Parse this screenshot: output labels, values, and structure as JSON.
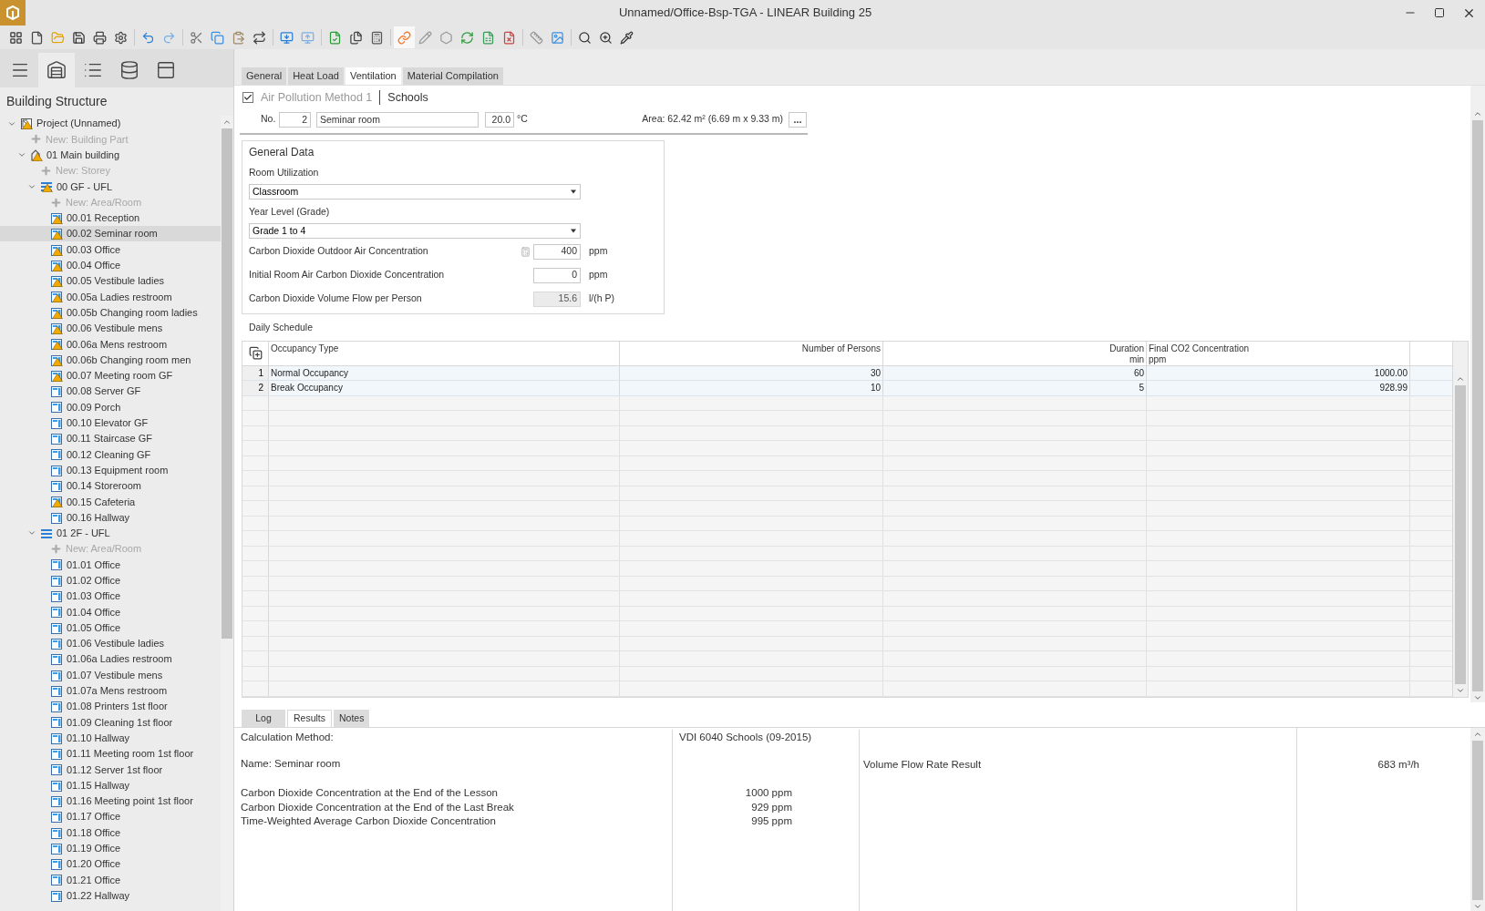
{
  "window": {
    "title": "Unnamed/Office-Bsp-TGA - LINEAR Building 25"
  },
  "toolbar": {
    "link_active": true
  },
  "sidebar": {
    "views": [
      {
        "selected": false
      },
      {
        "selected": true
      },
      {
        "selected": false
      },
      {
        "selected": false
      },
      {
        "selected": false
      }
    ],
    "title": "Building Structure",
    "tree": [
      {
        "label": "Project (Unnamed)",
        "kind": "project",
        "warning": true,
        "selected": false,
        "expanded": true,
        "children": [
          {
            "label": "New: Building Part",
            "kind": "new",
            "selected": false
          },
          {
            "label": "01 Main building",
            "kind": "building",
            "warning": true,
            "selected": false,
            "expanded": true,
            "children": [
              {
                "label": "New: Storey",
                "kind": "new",
                "selected": false
              },
              {
                "label": "00 GF - UFL",
                "kind": "storey",
                "warning": true,
                "selected": false,
                "expanded": true,
                "children": [
                  {
                    "label": "New: Area/Room",
                    "kind": "new",
                    "selected": false
                  },
                  {
                    "label": "00.01 Reception",
                    "kind": "room",
                    "warning": true,
                    "selected": false
                  },
                  {
                    "label": "00.02 Seminar room",
                    "kind": "room",
                    "warning": true,
                    "selected": true
                  },
                  {
                    "label": "00.03 Office",
                    "kind": "room",
                    "warning": true,
                    "selected": false
                  },
                  {
                    "label": "00.04 Office",
                    "kind": "room",
                    "warning": true,
                    "selected": false
                  },
                  {
                    "label": "00.05 Vestibule ladies",
                    "kind": "room",
                    "warning": true,
                    "selected": false
                  },
                  {
                    "label": "00.05a Ladies restroom",
                    "kind": "room",
                    "warning": true,
                    "selected": false
                  },
                  {
                    "label": "00.05b Changing room ladies",
                    "kind": "room",
                    "warning": true,
                    "selected": false
                  },
                  {
                    "label": "00.06 Vestibule mens",
                    "kind": "room",
                    "warning": true,
                    "selected": false
                  },
                  {
                    "label": "00.06a Mens restroom",
                    "kind": "room",
                    "warning": true,
                    "selected": false
                  },
                  {
                    "label": "00.06b Changing room men",
                    "kind": "room",
                    "warning": true,
                    "selected": false
                  },
                  {
                    "label": "00.07 Meeting room GF",
                    "kind": "room",
                    "warning": true,
                    "selected": false
                  },
                  {
                    "label": "00.08 Server GF",
                    "kind": "room",
                    "warning": false,
                    "selected": false
                  },
                  {
                    "label": "00.09 Porch",
                    "kind": "room",
                    "warning": false,
                    "selected": false
                  },
                  {
                    "label": "00.10 Elevator GF",
                    "kind": "room",
                    "warning": false,
                    "selected": false
                  },
                  {
                    "label": "00.11 Staircase GF",
                    "kind": "room",
                    "warning": false,
                    "selected": false
                  },
                  {
                    "label": "00.12 Cleaning GF",
                    "kind": "room",
                    "warning": false,
                    "selected": false
                  },
                  {
                    "label": "00.13 Equipment room",
                    "kind": "room",
                    "warning": false,
                    "selected": false
                  },
                  {
                    "label": "00.14 Storeroom",
                    "kind": "room",
                    "warning": false,
                    "selected": false
                  },
                  {
                    "label": "00.15 Cafeteria",
                    "kind": "room",
                    "warning": true,
                    "selected": false
                  },
                  {
                    "label": "00.16 Hallway",
                    "kind": "room",
                    "warning": false,
                    "selected": false
                  }
                ]
              },
              {
                "label": "01 2F - UFL",
                "kind": "storey",
                "warning": false,
                "selected": false,
                "expanded": true,
                "children": [
                  {
                    "label": "New: Area/Room",
                    "kind": "new",
                    "selected": false
                  },
                  {
                    "label": "01.01 Office",
                    "kind": "room",
                    "warning": false,
                    "selected": false
                  },
                  {
                    "label": "01.02 Office",
                    "kind": "room",
                    "warning": false,
                    "selected": false
                  },
                  {
                    "label": "01.03 Office",
                    "kind": "room",
                    "warning": false,
                    "selected": false
                  },
                  {
                    "label": "01.04 Office",
                    "kind": "room",
                    "warning": false,
                    "selected": false
                  },
                  {
                    "label": "01.05 Office",
                    "kind": "room",
                    "warning": false,
                    "selected": false
                  },
                  {
                    "label": "01.06 Vestibule ladies",
                    "kind": "room",
                    "warning": false,
                    "selected": false
                  },
                  {
                    "label": "01.06a Ladies restroom",
                    "kind": "room",
                    "warning": false,
                    "selected": false
                  },
                  {
                    "label": "01.07 Vestibule mens",
                    "kind": "room",
                    "warning": false,
                    "selected": false
                  },
                  {
                    "label": "01.07a Mens restroom",
                    "kind": "room",
                    "warning": false,
                    "selected": false
                  },
                  {
                    "label": "01.08 Printers 1st floor",
                    "kind": "room",
                    "warning": false,
                    "selected": false
                  },
                  {
                    "label": "01.09 Cleaning 1st floor",
                    "kind": "room",
                    "warning": false,
                    "selected": false
                  },
                  {
                    "label": "01.10 Hallway",
                    "kind": "room",
                    "warning": false,
                    "selected": false
                  },
                  {
                    "label": "01.11 Meeting room 1st floor",
                    "kind": "room",
                    "warning": false,
                    "selected": false
                  },
                  {
                    "label": "01.12 Server 1st floor",
                    "kind": "room",
                    "warning": false,
                    "selected": false
                  },
                  {
                    "label": "01.15 Hallway",
                    "kind": "room",
                    "warning": false,
                    "selected": false
                  },
                  {
                    "label": "01.16 Meeting point 1st floor",
                    "kind": "room",
                    "warning": false,
                    "selected": false
                  },
                  {
                    "label": "01.17 Office",
                    "kind": "room",
                    "warning": false,
                    "selected": false
                  },
                  {
                    "label": "01.18 Office",
                    "kind": "room",
                    "warning": false,
                    "selected": false
                  },
                  {
                    "label": "01.19 Office",
                    "kind": "room",
                    "warning": false,
                    "selected": false
                  },
                  {
                    "label": "01.20 Office",
                    "kind": "room",
                    "warning": false,
                    "selected": false
                  },
                  {
                    "label": "01.21 Office",
                    "kind": "room",
                    "warning": false,
                    "selected": false
                  },
                  {
                    "label": "01.22 Hallway",
                    "kind": "room",
                    "warning": false,
                    "selected": false
                  }
                ]
              }
            ]
          }
        ]
      }
    ]
  },
  "tabs": [
    {
      "label": "General",
      "selected": false
    },
    {
      "label": "Heat Load",
      "selected": false
    },
    {
      "label": "Ventilation",
      "selected": true
    },
    {
      "label": "Material Compilation",
      "selected": false
    }
  ],
  "method": {
    "checked": true,
    "label": "Air Pollution Method 1",
    "type": "Schools"
  },
  "room": {
    "no_label": "No.",
    "no": "2",
    "name": "Seminar room",
    "temperature": "20.0",
    "temp_unit": "°C",
    "area": "Area: 62.42  m² (6.69 m x 9.33 m)",
    "more": "..."
  },
  "general_data": {
    "title": "General Data",
    "fields": [
      {
        "kind": "select",
        "label": "Room Utilization",
        "value": "Classroom"
      },
      {
        "kind": "select",
        "label": "Year Level (Grade)",
        "value": "Grade 1 to 4"
      },
      {
        "kind": "number",
        "label": "Carbon Dioxide Outdoor Air Concentration",
        "value": "400",
        "unit": "ppm",
        "calculator": true
      },
      {
        "kind": "number",
        "label": "Initial Room Air Carbon Dioxide Concentration",
        "value": "0",
        "unit": "ppm"
      },
      {
        "kind": "readonly",
        "label": "Carbon Dioxide Volume Flow per Person",
        "value": "15.6",
        "unit": "l/(h P)"
      }
    ]
  },
  "schedule": {
    "title": "Daily Schedule",
    "columns": [
      {
        "label": "Occupancy Type"
      },
      {
        "label": "Number of Persons"
      },
      {
        "label": "Duration",
        "unit": "min"
      },
      {
        "label": "Final CO2 Concentration",
        "unit": "ppm"
      }
    ],
    "rows": [
      {
        "no": "1",
        "cells": [
          "Normal Occupancy",
          "30",
          "60",
          "1000.00"
        ]
      },
      {
        "no": "2",
        "cells": [
          "Break Occupancy",
          "10",
          "5",
          "928.99"
        ]
      }
    ]
  },
  "bottom_tabs": [
    {
      "label": "Log",
      "selected": false
    },
    {
      "label": "Results",
      "selected": true
    },
    {
      "label": "Notes",
      "selected": false
    }
  ],
  "results": {
    "method_label": "Calculation Method:",
    "method_value": "VDI 6040 Schools (09-2015)",
    "name": "Name: Seminar room",
    "volume_label": "Volume Flow Rate Result",
    "volume_value": "683 m³/h",
    "concentrations": [
      {
        "label": "Carbon Dioxide Concentration at the End of the Lesson",
        "value": "1000 ppm"
      },
      {
        "label": "Carbon Dioxide Concentration at the End of the Last Break",
        "value": "929 ppm"
      },
      {
        "label": "Time-Weighted Average Carbon Dioxide Concentration",
        "value": "995 ppm"
      }
    ]
  }
}
